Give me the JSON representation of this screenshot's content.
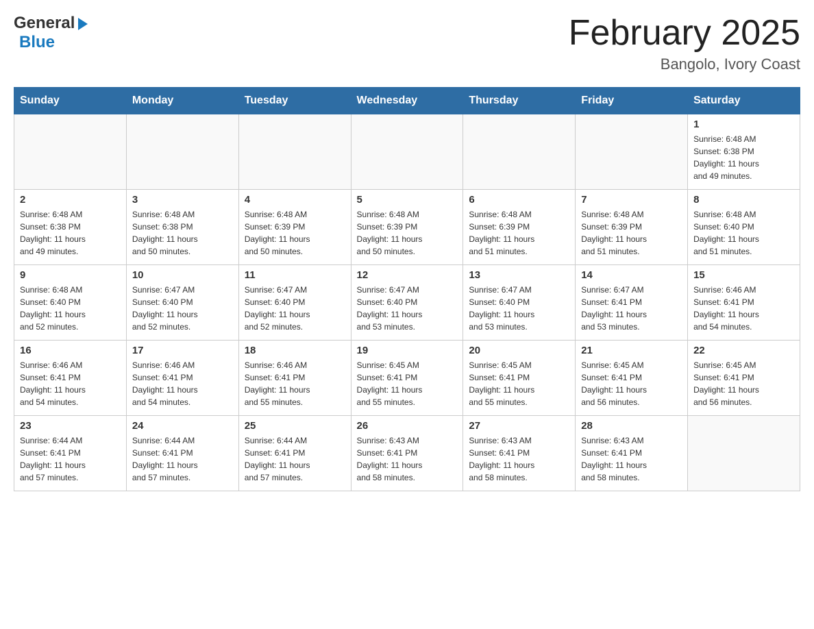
{
  "header": {
    "logo_general": "General",
    "logo_blue": "Blue",
    "month_title": "February 2025",
    "location": "Bangolo, Ivory Coast"
  },
  "weekdays": [
    "Sunday",
    "Monday",
    "Tuesday",
    "Wednesday",
    "Thursday",
    "Friday",
    "Saturday"
  ],
  "weeks": [
    [
      {
        "day": "",
        "info": ""
      },
      {
        "day": "",
        "info": ""
      },
      {
        "day": "",
        "info": ""
      },
      {
        "day": "",
        "info": ""
      },
      {
        "day": "",
        "info": ""
      },
      {
        "day": "",
        "info": ""
      },
      {
        "day": "1",
        "info": "Sunrise: 6:48 AM\nSunset: 6:38 PM\nDaylight: 11 hours\nand 49 minutes."
      }
    ],
    [
      {
        "day": "2",
        "info": "Sunrise: 6:48 AM\nSunset: 6:38 PM\nDaylight: 11 hours\nand 49 minutes."
      },
      {
        "day": "3",
        "info": "Sunrise: 6:48 AM\nSunset: 6:38 PM\nDaylight: 11 hours\nand 50 minutes."
      },
      {
        "day": "4",
        "info": "Sunrise: 6:48 AM\nSunset: 6:39 PM\nDaylight: 11 hours\nand 50 minutes."
      },
      {
        "day": "5",
        "info": "Sunrise: 6:48 AM\nSunset: 6:39 PM\nDaylight: 11 hours\nand 50 minutes."
      },
      {
        "day": "6",
        "info": "Sunrise: 6:48 AM\nSunset: 6:39 PM\nDaylight: 11 hours\nand 51 minutes."
      },
      {
        "day": "7",
        "info": "Sunrise: 6:48 AM\nSunset: 6:39 PM\nDaylight: 11 hours\nand 51 minutes."
      },
      {
        "day": "8",
        "info": "Sunrise: 6:48 AM\nSunset: 6:40 PM\nDaylight: 11 hours\nand 51 minutes."
      }
    ],
    [
      {
        "day": "9",
        "info": "Sunrise: 6:48 AM\nSunset: 6:40 PM\nDaylight: 11 hours\nand 52 minutes."
      },
      {
        "day": "10",
        "info": "Sunrise: 6:47 AM\nSunset: 6:40 PM\nDaylight: 11 hours\nand 52 minutes."
      },
      {
        "day": "11",
        "info": "Sunrise: 6:47 AM\nSunset: 6:40 PM\nDaylight: 11 hours\nand 52 minutes."
      },
      {
        "day": "12",
        "info": "Sunrise: 6:47 AM\nSunset: 6:40 PM\nDaylight: 11 hours\nand 53 minutes."
      },
      {
        "day": "13",
        "info": "Sunrise: 6:47 AM\nSunset: 6:40 PM\nDaylight: 11 hours\nand 53 minutes."
      },
      {
        "day": "14",
        "info": "Sunrise: 6:47 AM\nSunset: 6:41 PM\nDaylight: 11 hours\nand 53 minutes."
      },
      {
        "day": "15",
        "info": "Sunrise: 6:46 AM\nSunset: 6:41 PM\nDaylight: 11 hours\nand 54 minutes."
      }
    ],
    [
      {
        "day": "16",
        "info": "Sunrise: 6:46 AM\nSunset: 6:41 PM\nDaylight: 11 hours\nand 54 minutes."
      },
      {
        "day": "17",
        "info": "Sunrise: 6:46 AM\nSunset: 6:41 PM\nDaylight: 11 hours\nand 54 minutes."
      },
      {
        "day": "18",
        "info": "Sunrise: 6:46 AM\nSunset: 6:41 PM\nDaylight: 11 hours\nand 55 minutes."
      },
      {
        "day": "19",
        "info": "Sunrise: 6:45 AM\nSunset: 6:41 PM\nDaylight: 11 hours\nand 55 minutes."
      },
      {
        "day": "20",
        "info": "Sunrise: 6:45 AM\nSunset: 6:41 PM\nDaylight: 11 hours\nand 55 minutes."
      },
      {
        "day": "21",
        "info": "Sunrise: 6:45 AM\nSunset: 6:41 PM\nDaylight: 11 hours\nand 56 minutes."
      },
      {
        "day": "22",
        "info": "Sunrise: 6:45 AM\nSunset: 6:41 PM\nDaylight: 11 hours\nand 56 minutes."
      }
    ],
    [
      {
        "day": "23",
        "info": "Sunrise: 6:44 AM\nSunset: 6:41 PM\nDaylight: 11 hours\nand 57 minutes."
      },
      {
        "day": "24",
        "info": "Sunrise: 6:44 AM\nSunset: 6:41 PM\nDaylight: 11 hours\nand 57 minutes."
      },
      {
        "day": "25",
        "info": "Sunrise: 6:44 AM\nSunset: 6:41 PM\nDaylight: 11 hours\nand 57 minutes."
      },
      {
        "day": "26",
        "info": "Sunrise: 6:43 AM\nSunset: 6:41 PM\nDaylight: 11 hours\nand 58 minutes."
      },
      {
        "day": "27",
        "info": "Sunrise: 6:43 AM\nSunset: 6:41 PM\nDaylight: 11 hours\nand 58 minutes."
      },
      {
        "day": "28",
        "info": "Sunrise: 6:43 AM\nSunset: 6:41 PM\nDaylight: 11 hours\nand 58 minutes."
      },
      {
        "day": "",
        "info": ""
      }
    ]
  ]
}
